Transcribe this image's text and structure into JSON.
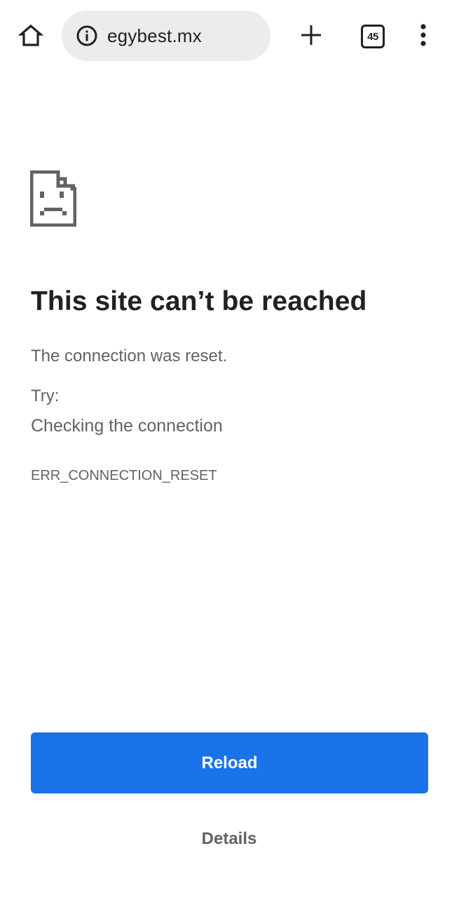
{
  "toolbar": {
    "url": "egybest.mx",
    "tab_count": "45",
    "icons": {
      "home": "home-icon",
      "site_info": "info-icon",
      "new_tab": "plus-icon",
      "tab_switcher": "tab-switcher-icon",
      "menu": "more-vert-icon"
    }
  },
  "error": {
    "icon": "sad-page-icon",
    "title": "This site can’t be reached",
    "description": "The connection was reset.",
    "try_label": "Try:",
    "suggestions": [
      "Checking the connection"
    ],
    "code": "ERR_CONNECTION_RESET"
  },
  "actions": {
    "reload_label": "Reload",
    "details_label": "Details"
  },
  "colors": {
    "accent": "#1a73e8",
    "omnibox_bg": "#ececee",
    "secondary_text": "#5f6368",
    "primary_text": "#202124"
  }
}
